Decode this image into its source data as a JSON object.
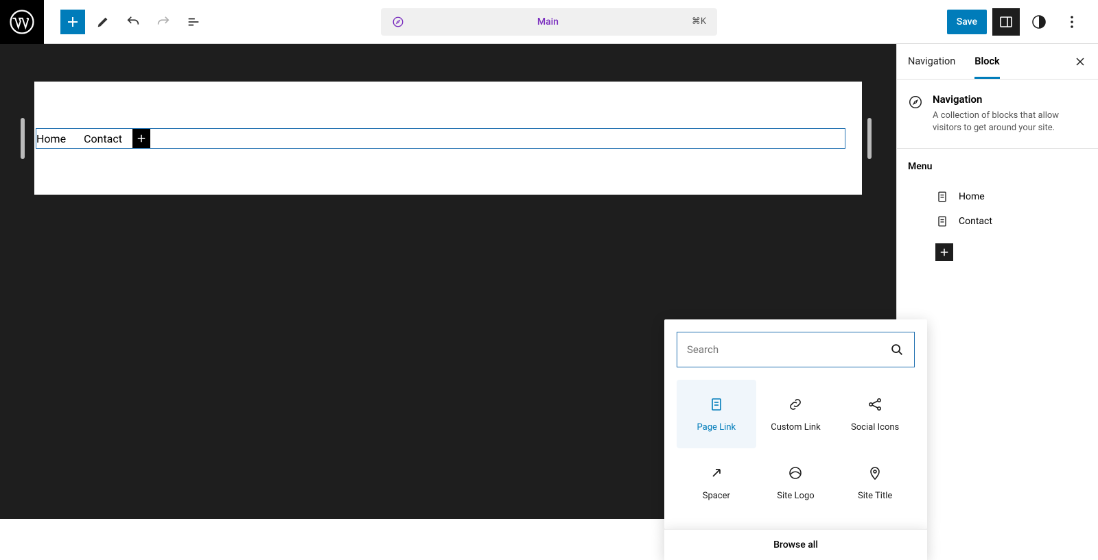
{
  "toolbar": {
    "center_label": "Main",
    "center_shortcut": "⌘K",
    "save_label": "Save"
  },
  "canvas": {
    "nav_items": [
      "Home",
      "Contact"
    ]
  },
  "sidebar": {
    "tabs": [
      "Navigation",
      "Block"
    ],
    "active_tab": 1,
    "block_title": "Navigation",
    "block_desc": "A collection of blocks that allow visitors to get around your site.",
    "menu_heading": "Menu",
    "menu_items": [
      "Home",
      "Contact"
    ]
  },
  "inserter": {
    "search_placeholder": "Search",
    "items": [
      {
        "label": "Page Link",
        "icon": "page-link",
        "highlighted": true
      },
      {
        "label": "Custom Link",
        "icon": "custom-link",
        "highlighted": false
      },
      {
        "label": "Social Icons",
        "icon": "social-icons",
        "highlighted": false
      },
      {
        "label": "Spacer",
        "icon": "spacer",
        "highlighted": false
      },
      {
        "label": "Site Logo",
        "icon": "site-logo",
        "highlighted": false
      },
      {
        "label": "Site Title",
        "icon": "site-title",
        "highlighted": false
      }
    ],
    "browse_all": "Browse all"
  }
}
